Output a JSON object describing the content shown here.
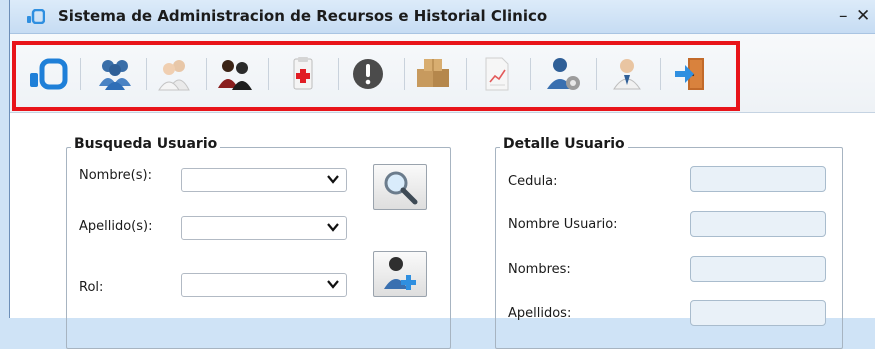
{
  "window": {
    "title": "Sistema de Administracion de Recursos e Historial Clinico",
    "minimize_glyph": "–",
    "close_glyph": "✕"
  },
  "toolbar": {
    "items": [
      {
        "icon": "app-logo-icon"
      },
      {
        "icon": "users-icon"
      },
      {
        "icon": "doctors-icon"
      },
      {
        "icon": "patients-icon"
      },
      {
        "icon": "medical-record-icon"
      },
      {
        "icon": "alert-icon"
      },
      {
        "icon": "resources-boxes-icon"
      },
      {
        "icon": "report-chart-icon"
      },
      {
        "icon": "user-settings-icon"
      },
      {
        "icon": "doctor-profile-icon"
      },
      {
        "icon": "exit-door-icon"
      }
    ]
  },
  "search_group": {
    "legend": "Busqueda Usuario",
    "nombre_label": "Nombre(s):",
    "nombre_value": "",
    "apellido_label": "Apellido(s):",
    "apellido_value": "",
    "rol_label": "Rol:",
    "rol_value": "",
    "search_button_icon": "magnifier-icon",
    "add_user_button_icon": "add-user-icon"
  },
  "detail_group": {
    "legend": "Detalle Usuario",
    "cedula_label": "Cedula:",
    "nombre_usuario_label": "Nombre Usuario:",
    "nombres_label": "Nombres:",
    "apellidos_label": "Apellidos:"
  },
  "colors": {
    "highlight_border": "#e8141a",
    "title_bar": "#c6dcf3",
    "input_fill": "#e9f1f8"
  }
}
